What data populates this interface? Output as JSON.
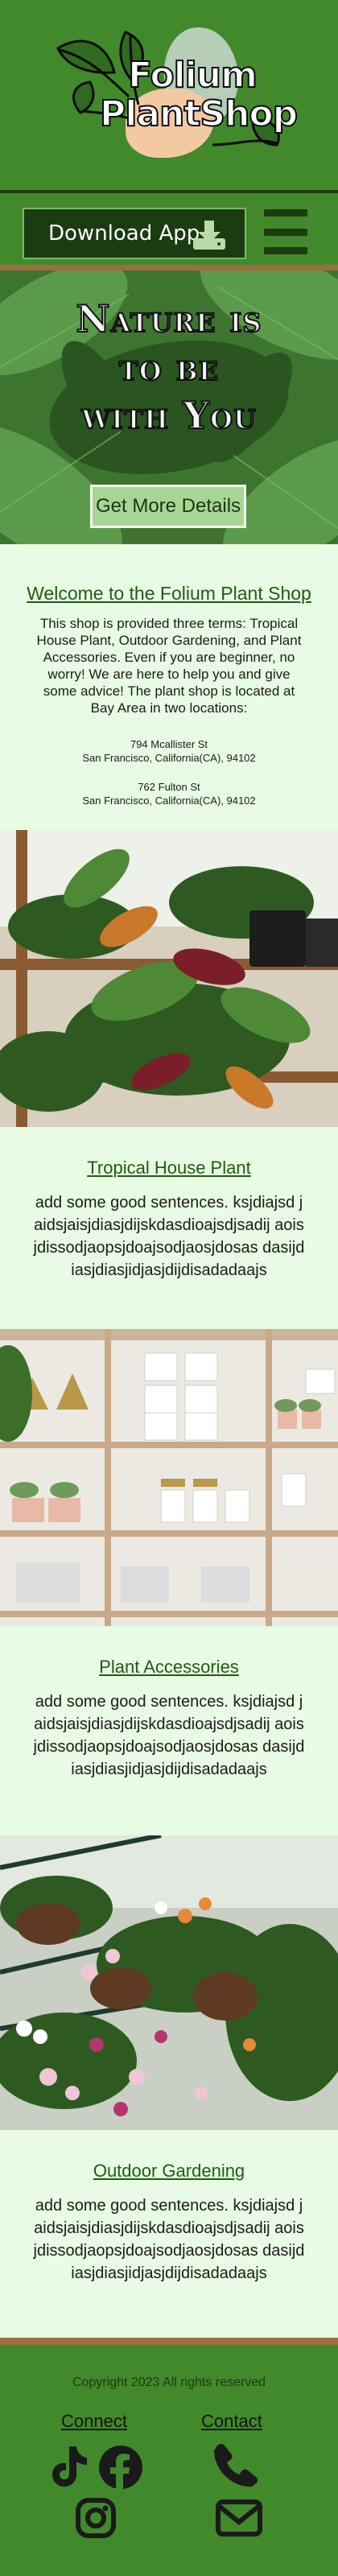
{
  "header": {
    "logo_line1": "Folium",
    "logo_line2": "PlantShop"
  },
  "nav": {
    "download_label": "Download App",
    "download_icon": "download-icon",
    "menu_icon": "hamburger-menu-icon"
  },
  "hero": {
    "title_line1": "Nature is",
    "title_line2": "to be",
    "title_line3": "with You",
    "button_label": "Get More Details"
  },
  "welcome": {
    "title": "Welcome to the Folium Plant Shop",
    "intro": "This shop is provided three terms: Tropical House Plant, Outdoor Gardening, and Plant Accessories. Even if you are beginner, no worry! We are here to help you and give some advice! The plant shop is located at Bay Area in two locations:",
    "address1_line1": "794 Mcallister St",
    "address1_line2": "San Francisco, California(CA), 94102",
    "address2_line1": "762 Fulton St",
    "address2_line2": "San Francisco, California(CA), 94102"
  },
  "sections": [
    {
      "title": "Tropical House Plant",
      "text": "add some good sentences. ksjdiajsd jaidsjaisjdiasjdijskdasdioajsdjsadij aoisjdissodjaopsjdoajsodjaosjdosas dasijdiasjdiasjidjasjdijdisadadaajs"
    },
    {
      "title": "Plant Accessories",
      "text": "add some good sentences. ksjdiajsd jaidsjaisjdiasjdijskdasdioajsdjsadij aoisjdissodjaopsjdoajsodjaosjdosas dasijdiasjdiasjidjasjdijdisadadaajs"
    },
    {
      "title": "Outdoor Gardening",
      "text": "add some good sentences. ksjdiajsd jaidsjaisjdiasjdijskdasdioajsdjsadij aoisjdissodjaopsjdoajsodjaosjdosas dasijdiasjdiasjidjasjdijdisadadaajs"
    }
  ],
  "footer": {
    "copyright": "Copyright 2023 All rights reserved",
    "connect_label": "Connect",
    "contact_label": "Contact",
    "icons": [
      "tiktok-icon",
      "facebook-icon",
      "instagram-icon",
      "phone-icon",
      "email-icon"
    ]
  },
  "colors": {
    "header_green": "#41892b",
    "dark_green": "#1b3b10",
    "page_bg": "#e8fbe4",
    "heading_green": "#1f5c14",
    "wood_border": "#9b6e3d"
  }
}
